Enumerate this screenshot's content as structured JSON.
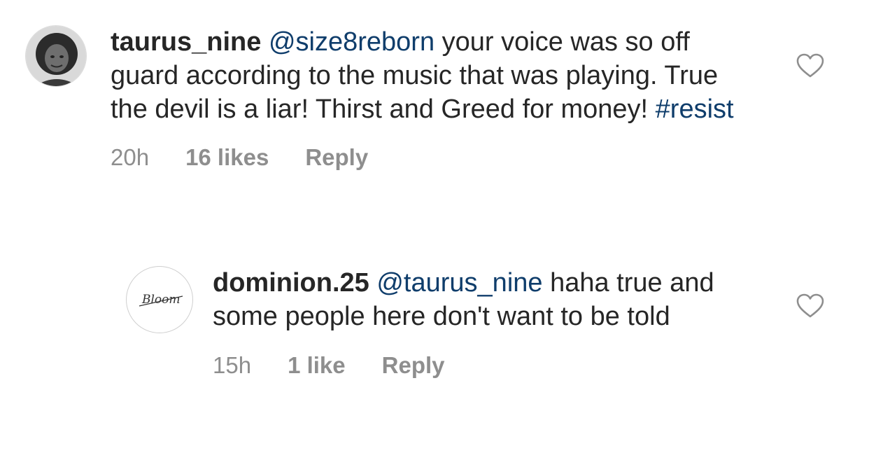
{
  "comments": [
    {
      "username": "taurus_nine",
      "mention": "@size8reborn",
      "text_1": "your voice was so off guard according to the music that was playing. True the devil is a liar! Thirst and Greed for money!",
      "hashtag": "#resist",
      "time": "20h",
      "likes": "16 likes",
      "reply_label": "Reply",
      "avatar": "profile-photo"
    },
    {
      "username": "dominion.25",
      "mention": "@taurus_nine",
      "text_1": "haha true and some people here don't want to be told",
      "time": "15h",
      "likes": "1 like",
      "reply_label": "Reply",
      "avatar": "bloom-logo",
      "avatar_text": "Bloom"
    }
  ],
  "icons": {
    "like": "heart-outline-icon"
  },
  "colors": {
    "text": "#262626",
    "link": "#0f3d6b",
    "meta": "#8e8e8e"
  }
}
